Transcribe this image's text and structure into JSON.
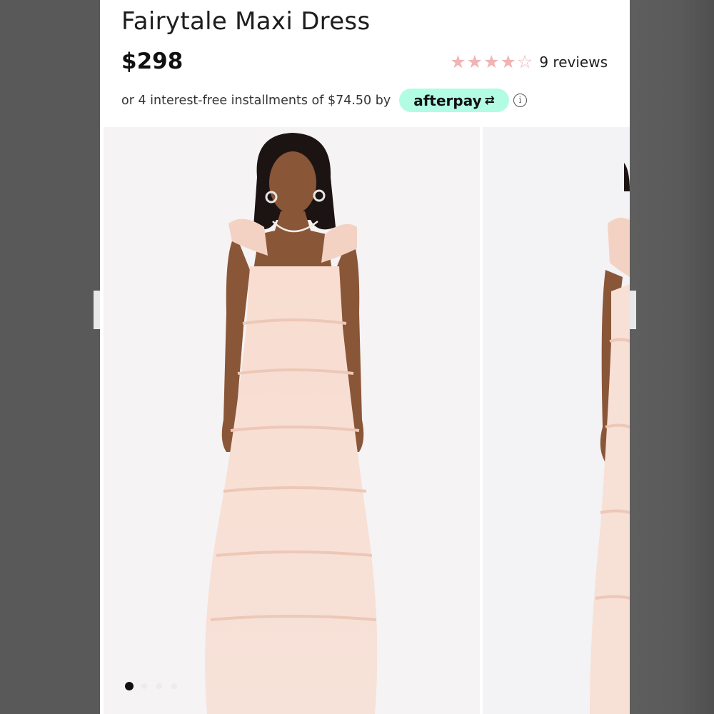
{
  "product": {
    "title": "Fairytale Maxi Dress",
    "price": "$298",
    "rating": {
      "value": 4,
      "max": 5,
      "reviews_label": "9 reviews"
    },
    "installments": {
      "text": "or 4 interest-free installments of $74.50 by",
      "provider": "afterpay",
      "info_glyph": "i"
    }
  },
  "gallery": {
    "total_images": 4,
    "active_index": 0
  },
  "colors": {
    "star": "#f1b3b3",
    "afterpay_badge": "#b2fce4",
    "dress": "#f6d9cb"
  },
  "icons": {
    "star": "star-icon",
    "afterpay_arrow": "afterpay-arrow-icon",
    "info": "info-icon"
  }
}
